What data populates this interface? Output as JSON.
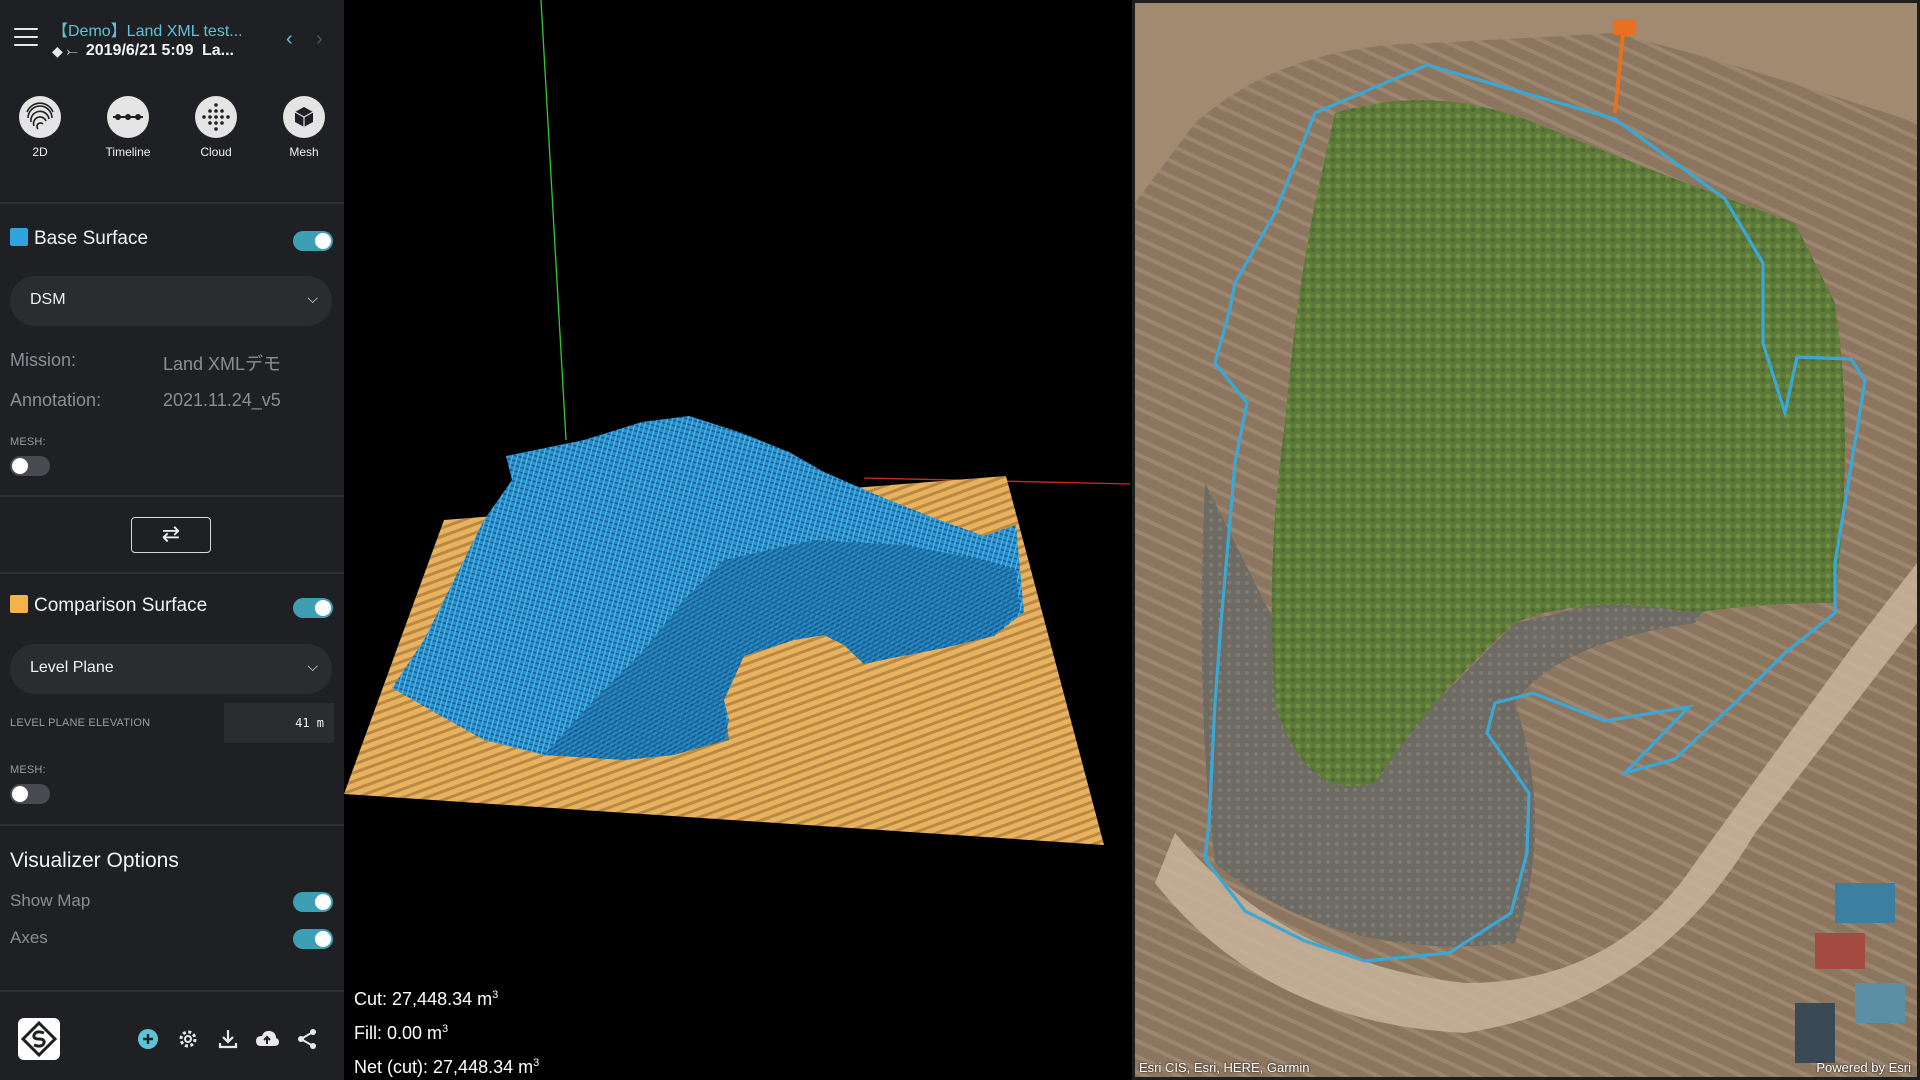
{
  "header": {
    "title": "【Demo】Land XML test...",
    "date": "2019/6/21 5:09",
    "date_suffix": "La...",
    "prev_glyph": "‹",
    "next_glyph": "›"
  },
  "view_modes": [
    {
      "label": "2D",
      "icon": "fingerprint-icon"
    },
    {
      "label": "Timeline",
      "icon": "timeline-icon"
    },
    {
      "label": "Cloud",
      "icon": "point-cloud-icon"
    },
    {
      "label": "Mesh",
      "icon": "cube-icon"
    }
  ],
  "base_surface": {
    "title": "Base Surface",
    "color": "#2fa4da",
    "enabled": true,
    "selected": "DSM",
    "mission_label": "Mission:",
    "mission_value": "Land XMLデモ",
    "annotation_label": "Annotation:",
    "annotation_value": "2021.11.24_v5",
    "mesh_label": "MESH:",
    "mesh_enabled": false
  },
  "swap_glyph": "⇄",
  "comparison_surface": {
    "title": "Comparison Surface",
    "color": "#f5b14a",
    "enabled": true,
    "selected": "Level Plane",
    "elevation_label": "LEVEL PLANE ELEVATION",
    "elevation_value": "41 m",
    "mesh_label": "MESH:",
    "mesh_enabled": false
  },
  "visualizer": {
    "title": "Visualizer Options",
    "options": [
      {
        "label": "Show Map",
        "enabled": true
      },
      {
        "label": "Axes",
        "enabled": true
      }
    ]
  },
  "collapse_glyph": "‹",
  "stats": {
    "cut_label": "Cut:",
    "cut_value": "27,448.34 m",
    "fill_label": "Fill:",
    "fill_value": "0.00 m",
    "net_label": "Net (cut):",
    "net_value": "27,448.34 m",
    "unit_exp": "3"
  },
  "map": {
    "credit": "Esri CIS, Esri, HERE, Garmin",
    "powered": "Powered by Esri",
    "boundary_color": "#3aa8d6"
  },
  "colors": {
    "accent": "#5fc3d8",
    "toggle_on": "#3e9fb4",
    "sidebar_bg": "#1f2023"
  }
}
